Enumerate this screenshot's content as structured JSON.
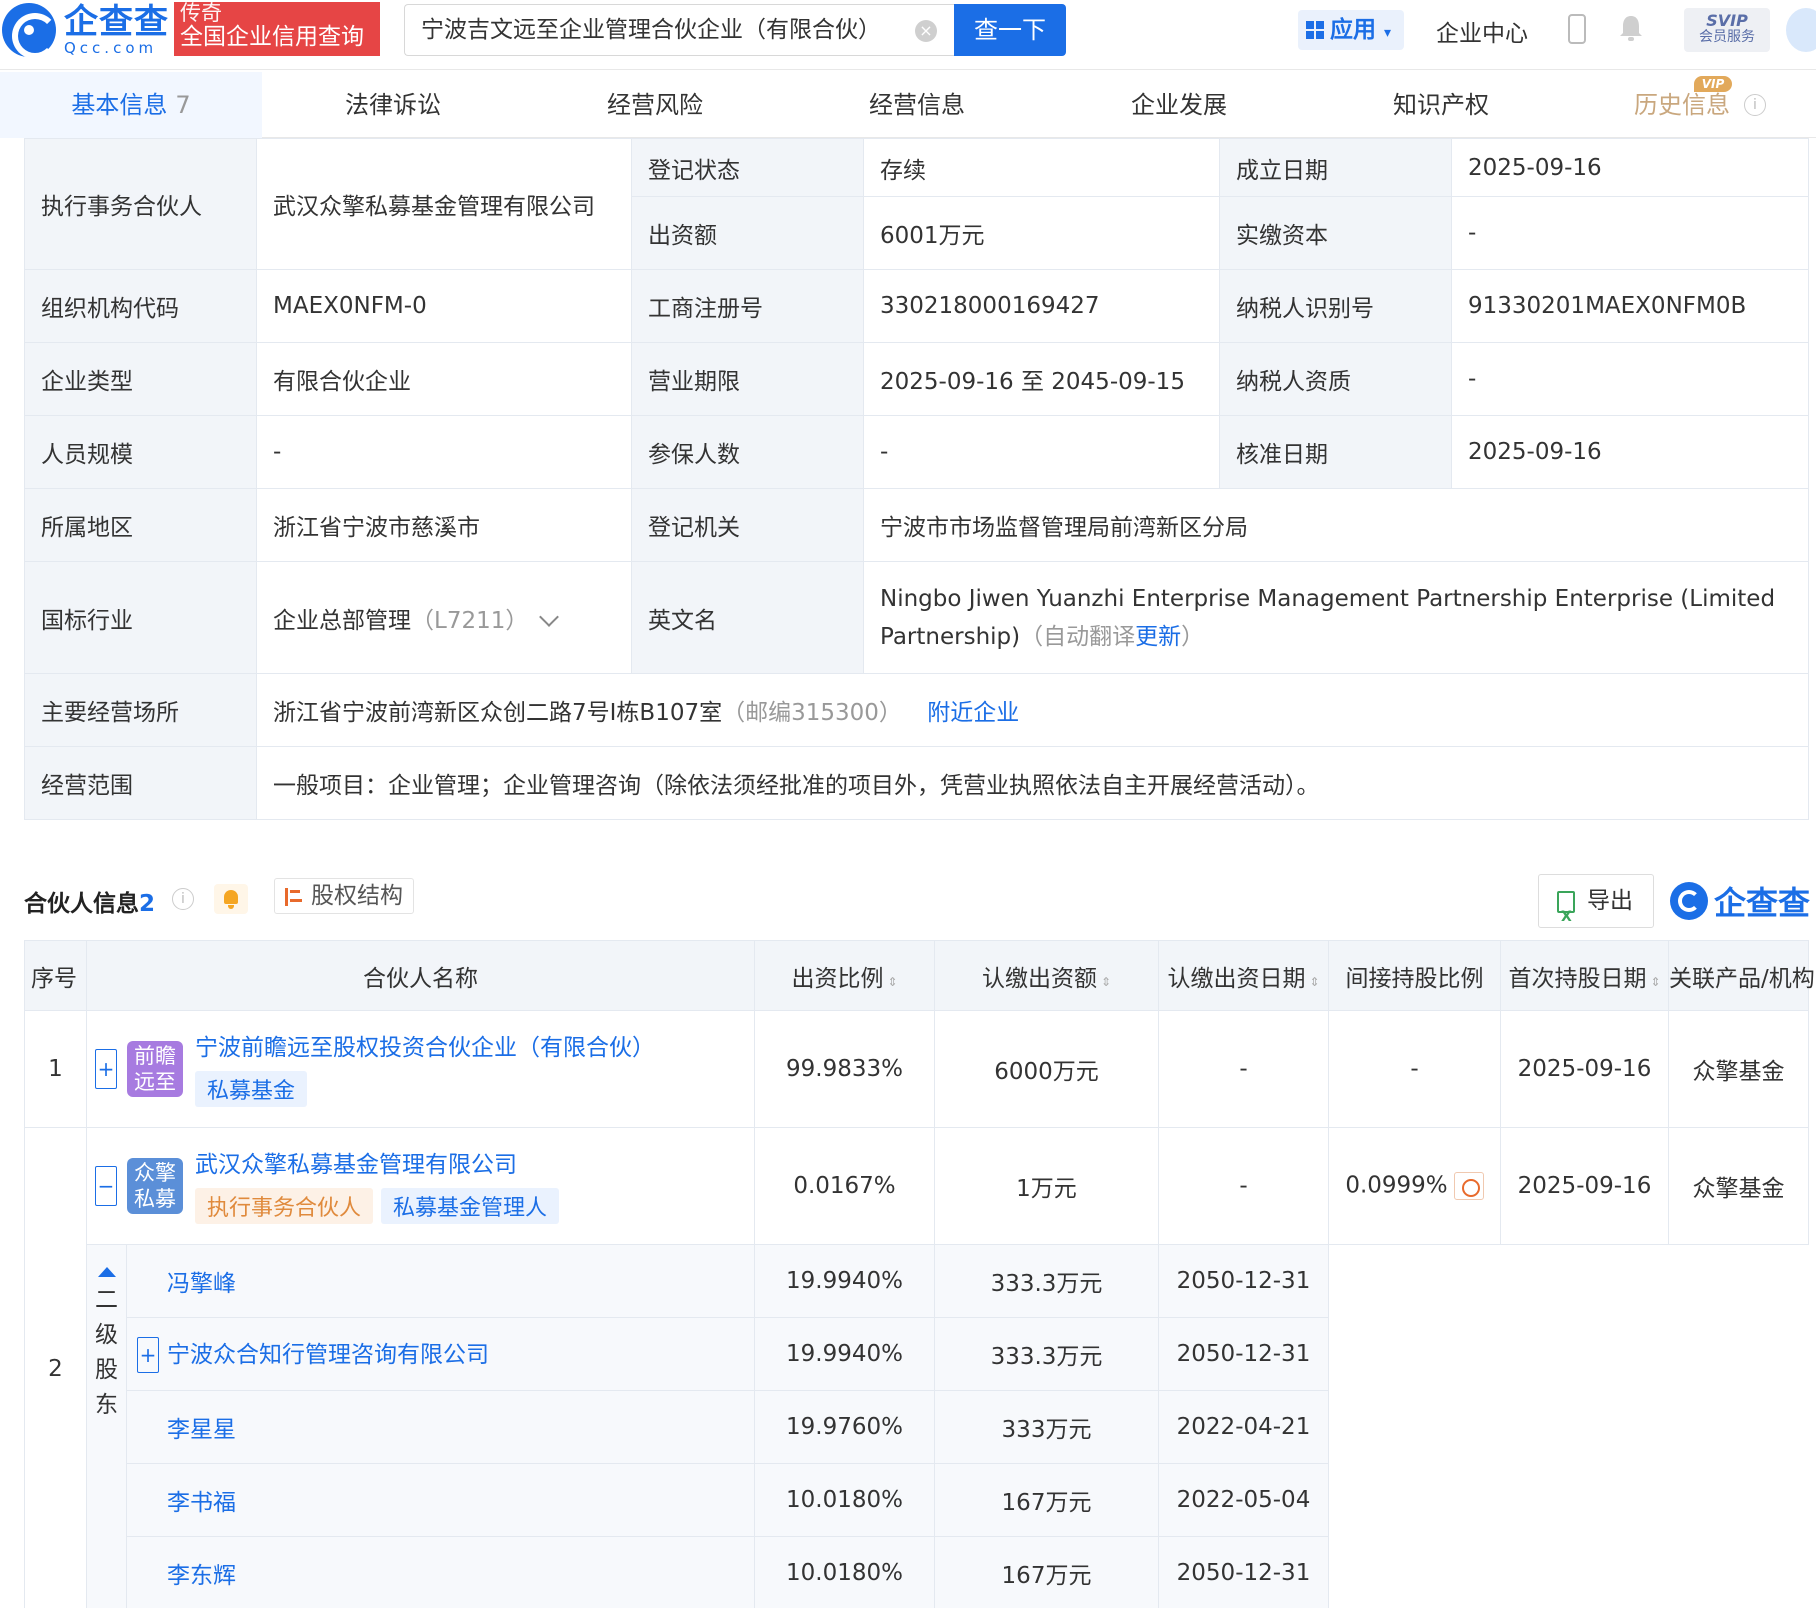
{
  "header": {
    "logo_cn": "企查查",
    "logo_en": "Qcc.com",
    "banner_line1": "传奇",
    "banner_line2": "全国企业信用查询",
    "search_value": "宁波吉文远至企业管理合伙企业（有限合伙）",
    "search_button": "查一下",
    "app_label": "应用",
    "enterprise_center": "企业中心",
    "svip_line1": "SVIP",
    "svip_line2": "会员服务"
  },
  "tabs": [
    {
      "label": "基本信息",
      "count": "7"
    },
    {
      "label": "法律诉讼"
    },
    {
      "label": "经营风险"
    },
    {
      "label": "经营信息"
    },
    {
      "label": "企业发展"
    },
    {
      "label": "知识产权"
    },
    {
      "label": "历史信息",
      "tag": "VIP"
    }
  ],
  "basic_info": {
    "partner_key": "执行事务合伙人",
    "partner_value": "武汉众擎私募基金管理有限公司",
    "status_key": "登记状态",
    "status_value": "存续",
    "founded_key": "成立日期",
    "founded_value": "2025-09-16",
    "capital_key": "出资额",
    "capital_value": "6001万元",
    "paid_key": "实缴资本",
    "paid_value": "-",
    "org_code_key": "组织机构代码",
    "org_code_value": "MAEX0NFM-0",
    "reg_no_key": "工商注册号",
    "reg_no_value": "330218000169427",
    "tax_id_key": "纳税人识别号",
    "tax_id_value": "91330201MAEX0NFM0B",
    "type_key": "企业类型",
    "type_value": "有限合伙企业",
    "term_key": "营业期限",
    "term_value": "2025-09-16 至 2045-09-15",
    "tax_qual_key": "纳税人资质",
    "tax_qual_value": "-",
    "staff_key": "人员规模",
    "staff_value": "-",
    "insured_key": "参保人数",
    "insured_value": "-",
    "approve_key": "核准日期",
    "approve_value": "2025-09-16",
    "region_key": "所属地区",
    "region_value": "浙江省宁波市慈溪市",
    "authority_key": "登记机关",
    "authority_value": "宁波市市场监督管理局前湾新区分局",
    "industry_key": "国标行业",
    "industry_value": "企业总部管理",
    "industry_code": "（L7211）",
    "en_name_key": "英文名",
    "en_name_value": "Ningbo Jiwen Yuanzhi Enterprise Management Partnership Enterprise (Limited Partnership)",
    "en_name_note_prefix": "（自动翻译",
    "en_name_note_link": "更新",
    "en_name_note_suffix": "）",
    "address_key": "主要经营场所",
    "address_value": "浙江省宁波前湾新区众创二路7号I栋B107室",
    "address_zip": "（邮编315300）",
    "nearby_link": "附近企业",
    "scope_key": "经营范围",
    "scope_value": "一般项目：企业管理；企业管理咨询（除依法须经批准的项目外，凭营业执照依法自主开展经营活动）。"
  },
  "partners": {
    "title": "合伙人信息",
    "count": "2",
    "equity_button": "股权结构",
    "export_button": "导出",
    "brand": "企查查",
    "columns": [
      "序号",
      "合伙人名称",
      "出资比例",
      "认缴出资额",
      "认缴出资日期",
      "间接持股比例",
      "首次持股日期",
      "关联产品/机构"
    ],
    "rows": [
      {
        "index": "1",
        "logo": "前瞻远至",
        "logo_color": "#a77be0",
        "name": "宁波前瞻远至股权投资合伙企业（有限合伙）",
        "tags": [
          "私募基金"
        ],
        "ratio": "99.9833%",
        "amount": "6000万元",
        "date": "-",
        "indirect": "-",
        "first_date": "2025-09-16",
        "product": "众擎基金"
      },
      {
        "index": "2",
        "logo": "众擎私募",
        "logo_color": "#5b8fd8",
        "name": "武汉众擎私募基金管理有限公司",
        "tag_exec": "执行事务合伙人",
        "tag_mgr": "私募基金管理人",
        "ratio": "0.0167%",
        "amount": "1万元",
        "date": "-",
        "indirect": "0.0999%",
        "first_date": "2025-09-16",
        "product": "众擎基金"
      }
    ],
    "second_level_label": "二级股东",
    "second_level": [
      {
        "name": "冯擎峰",
        "ratio": "19.9940%",
        "amount": "333.3万元",
        "date": "2050-12-31"
      },
      {
        "name": "宁波众合知行管理咨询有限公司",
        "ratio": "19.9940%",
        "amount": "333.3万元",
        "date": "2050-12-31"
      },
      {
        "name": "李星星",
        "ratio": "19.9760%",
        "amount": "333万元",
        "date": "2022-04-21"
      },
      {
        "name": "李书福",
        "ratio": "10.0180%",
        "amount": "167万元",
        "date": "2022-05-04"
      },
      {
        "name": "李东辉",
        "ratio": "10.0180%",
        "amount": "167万元",
        "date": "2050-12-31"
      }
    ]
  }
}
